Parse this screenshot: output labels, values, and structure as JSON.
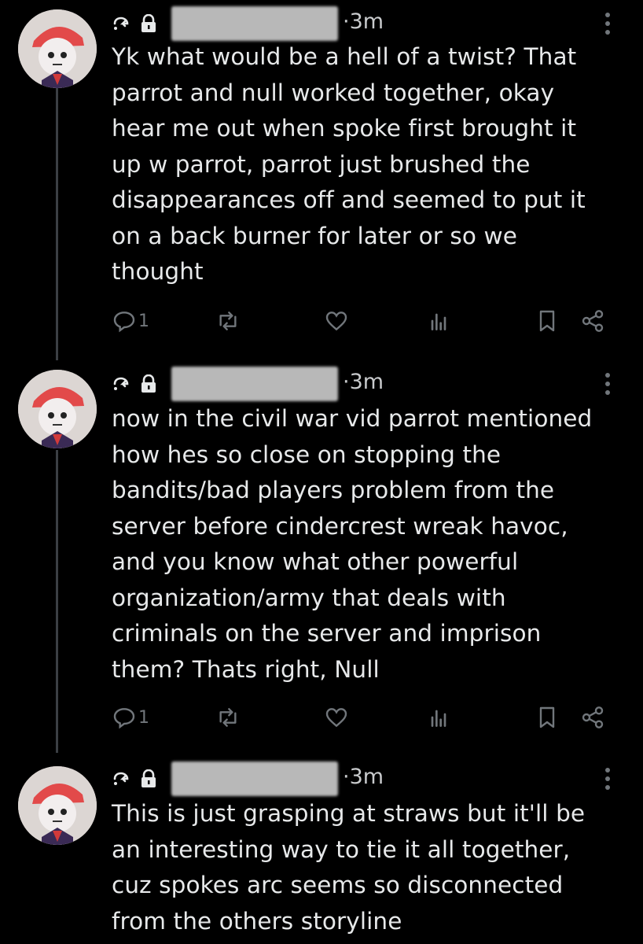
{
  "posts": [
    {
      "time": "·3m",
      "text": "Yk what would be a hell of a twist? That\nparrot and null worked together, okay\nhear me out when spoke first brought it\nup w parrot, parrot just brushed the\ndisappearances off and seemed to put it\non a back burner for later or so we\nthought",
      "reply_count": "1",
      "icons": [
        "reply-icon",
        "repost-icon",
        "like-icon",
        "views-icon",
        "bookmark-icon",
        "share-icon"
      ]
    },
    {
      "time": "·3m",
      "text": "now in the civil war vid parrot mentioned\nhow hes so close on stopping the\nbandits/bad players problem from the\nserver before cindercrest wreak havoc,\nand you know what other powerful\norganization/army that deals with\ncriminals on the server and imprison\nthem? Thats right, Null",
      "reply_count": "1",
      "icons": [
        "reply-icon",
        "repost-icon",
        "like-icon",
        "views-icon",
        "bookmark-icon",
        "share-icon"
      ]
    },
    {
      "time": "·3m",
      "text": "This is just grasping at straws but it'll be\nan interesting way to tie it all together,\ncuz spokes arc seems so disconnected\nfrom the others storyline",
      "icons": [
        "more-icon"
      ]
    }
  ],
  "colors": {
    "background": "#000000",
    "text": "#e7e9ea",
    "muted": "#71767b",
    "thread_line": "#3b3f44"
  }
}
